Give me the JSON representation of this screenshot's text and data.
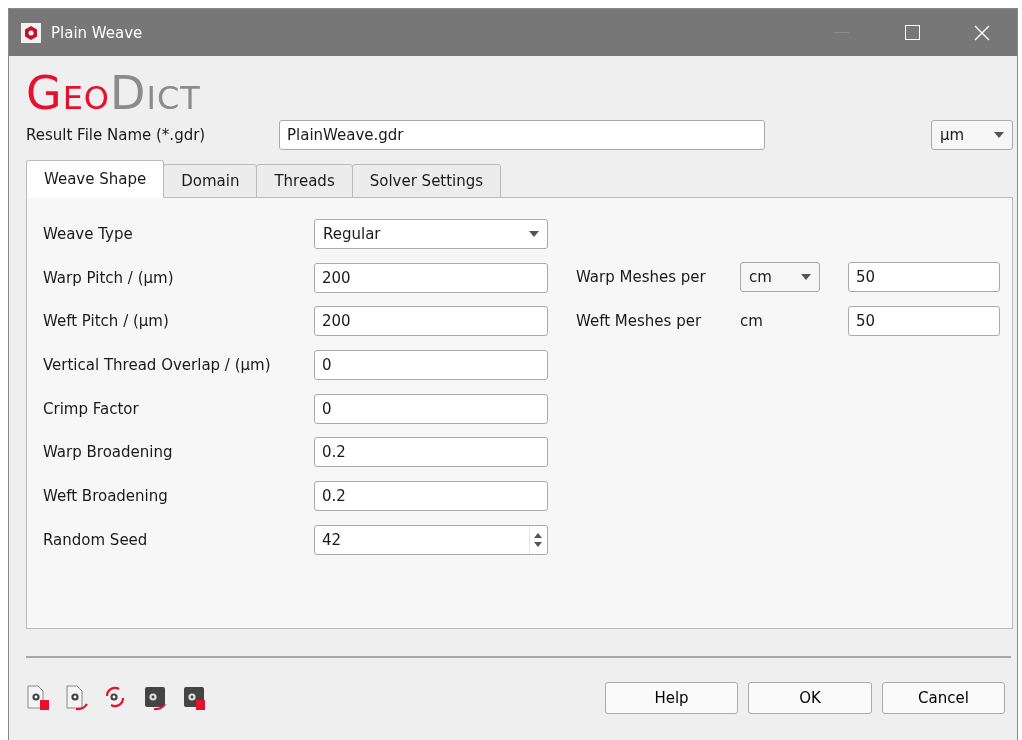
{
  "window": {
    "title": "Plain Weave"
  },
  "logo": [
    {
      "text": "Geo",
      "color": "#e8112d"
    },
    {
      "text": "Dict",
      "color": "#8c8c8c"
    }
  ],
  "result_file": {
    "label": "Result File Name (*.gdr)",
    "value": "PlainWeave.gdr"
  },
  "unit_select": {
    "value": "µm"
  },
  "tabs": [
    {
      "label": "Weave Shape",
      "selected": true
    },
    {
      "label": "Domain",
      "selected": false
    },
    {
      "label": "Threads",
      "selected": false
    },
    {
      "label": "Solver Settings",
      "selected": false
    }
  ],
  "fields": [
    {
      "label": "Weave Type",
      "kind": "combo",
      "value": "Regular"
    },
    {
      "label": "Warp Pitch / (µm)",
      "kind": "text",
      "value": "200"
    },
    {
      "label": "Weft Pitch / (µm)",
      "kind": "text",
      "value": "200"
    },
    {
      "label": "Vertical Thread Overlap / (µm)",
      "kind": "text",
      "value": "0"
    },
    {
      "label": "Crimp Factor",
      "kind": "text",
      "value": "0"
    },
    {
      "label": "Warp Broadening",
      "kind": "text",
      "value": "0.2"
    },
    {
      "label": "Weft Broadening",
      "kind": "text",
      "value": "0.2"
    },
    {
      "label": "Random Seed",
      "kind": "spin",
      "value": "42"
    }
  ],
  "meshes": [
    {
      "label": "Warp Meshes per",
      "kind": "combo",
      "unit": "cm",
      "value": "50"
    },
    {
      "label": "Weft Meshes per",
      "kind": "text",
      "unit": "cm",
      "value": "50"
    }
  ],
  "buttons": [
    "Help",
    "OK",
    "Cancel"
  ]
}
